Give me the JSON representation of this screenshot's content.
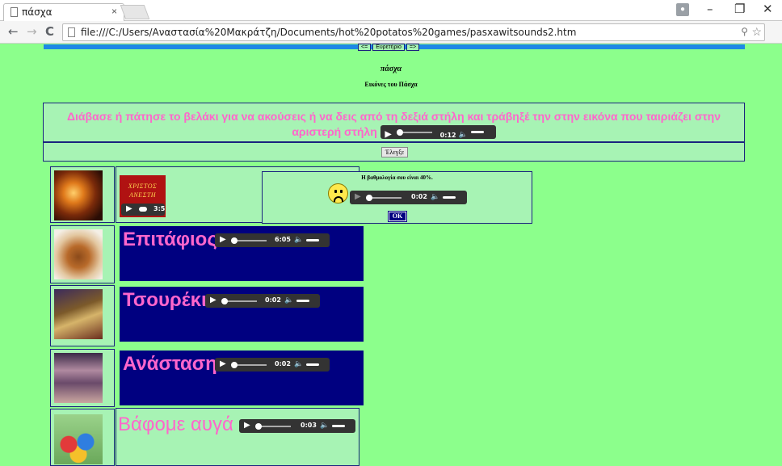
{
  "browser": {
    "tab_title": "πάσχα",
    "tab_close": "×",
    "url": "file:///C:/Users/Αναστασία%20Μακράτζη/Documents/hot%20potatos%20games/pasxawitsounds2.htm",
    "back_icon": "←",
    "forward_icon": "→",
    "reload_icon": "C",
    "minimize": "–",
    "restore": "❐",
    "close": "✕",
    "zoom_icon": "🔍",
    "star_icon": "☆",
    "user_icon": "👤"
  },
  "page": {
    "title": "πάσχα",
    "subtitle": "Εικόνες του Πάσχα",
    "instructions": "Διάβασε ή πάτησε το βελάκι για να ακούσεις ή να δεις από τη δεξιά στήλη και τράβηξέ την στην εικόνα που ταιριάζει στην αριστερή στήλη",
    "instructions_audio_time": "0:12",
    "check_label": "Έλεγξε",
    "mini_nav": [
      "<=",
      "Ευρετήριο",
      "=>"
    ]
  },
  "matched": {
    "label_line1": "ΧΡΙΣΤΟΣ",
    "label_line2": "ΑΝΕΣΤΗ",
    "audio_time": "3:5"
  },
  "cards": [
    {
      "label": "Επιτάφιος",
      "audio_time": "6:05"
    },
    {
      "label": "Τσουρέκι",
      "audio_time": "0:02"
    },
    {
      "label": "Ανάσταση",
      "audio_time": "0:02"
    },
    {
      "label": "Βάφομε αυγά",
      "audio_time": "0:03"
    }
  ],
  "feedback": {
    "text": "Η βαθμολογία σου είναι 40%.",
    "audio_time": "0:02",
    "ok_label": "OK",
    "face_icon": "sad-face-icon"
  },
  "colors": {
    "page_bg": "#8cff8c",
    "cell_bg": "#a7f3b4",
    "card_bg": "#000080",
    "label_pink": "#ff66cc",
    "accent_bar": "#1e88e5"
  }
}
